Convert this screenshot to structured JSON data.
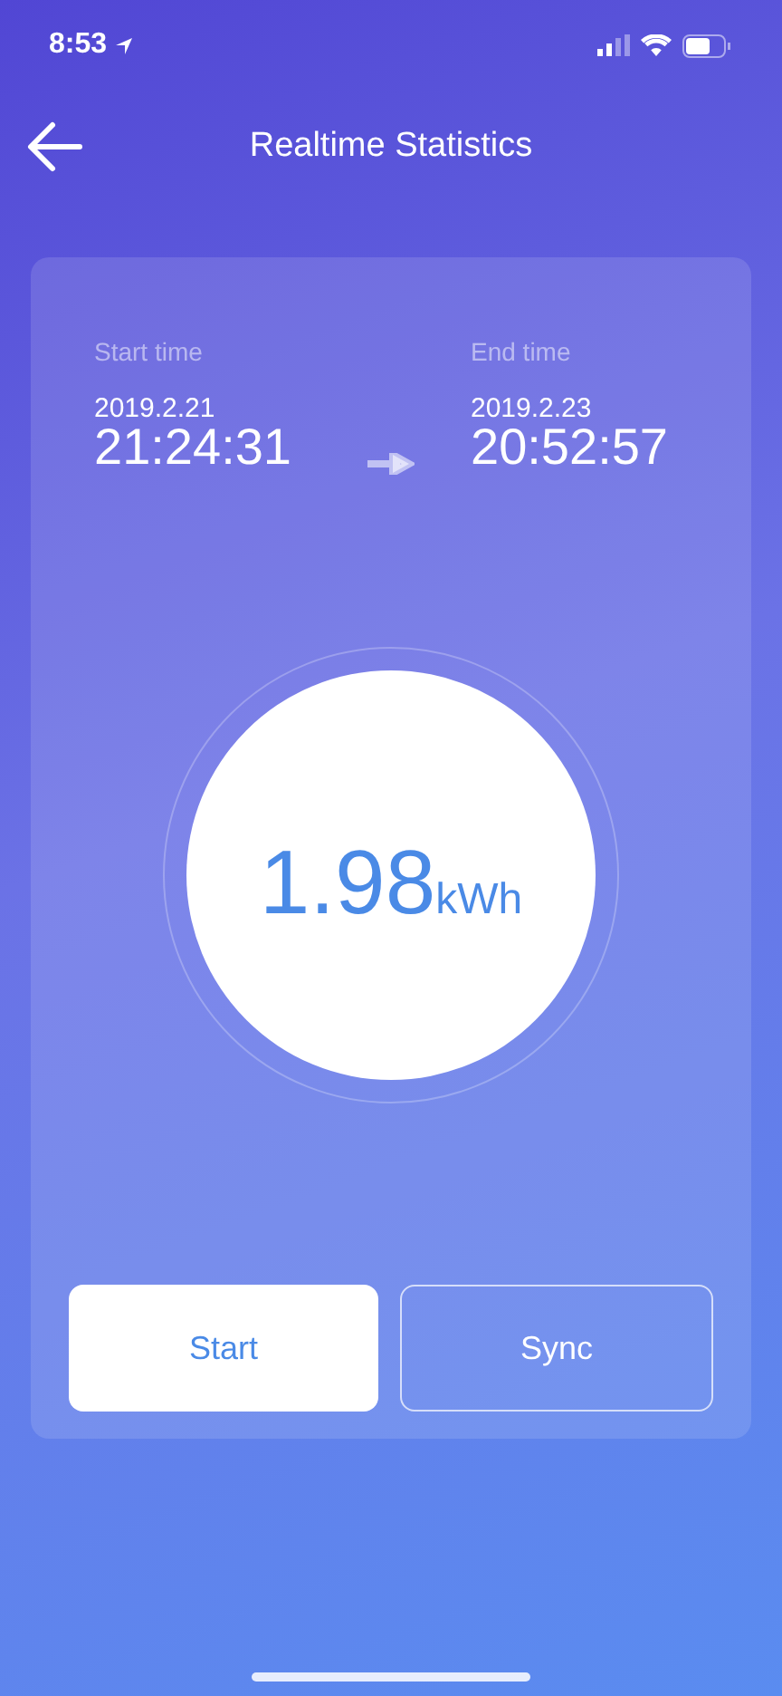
{
  "status_bar": {
    "time": "8:53"
  },
  "header": {
    "title": "Realtime Statistics"
  },
  "period": {
    "start": {
      "label": "Start time",
      "date": "2019.2.21",
      "time": "21:24:31"
    },
    "end": {
      "label": "End time",
      "date": "2019.2.23",
      "time": "20:52:57"
    }
  },
  "energy": {
    "value": "1.98",
    "unit": "kWh"
  },
  "buttons": [
    {
      "label": "Start",
      "kind": "filled"
    },
    {
      "label": "Sync",
      "kind": "outline"
    }
  ]
}
